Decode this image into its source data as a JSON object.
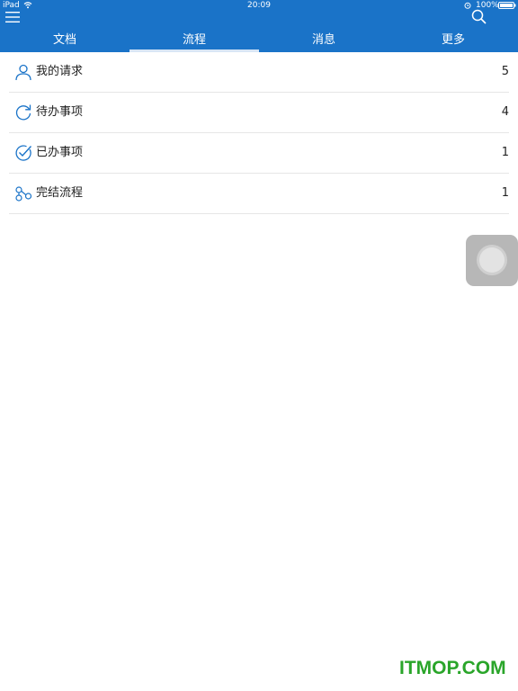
{
  "status_bar": {
    "carrier": "iPad",
    "time": "20:09",
    "battery": "100%",
    "icons": [
      "wifi-icon",
      "alarm-icon",
      "battery-icon"
    ]
  },
  "header": {
    "menu_icon": "menu-icon",
    "search_icon": "search-icon",
    "accent_color": "#1a73c8"
  },
  "tabs": [
    {
      "label": "文档",
      "active": false
    },
    {
      "label": "流程",
      "active": true
    },
    {
      "label": "消息",
      "active": false
    },
    {
      "label": "更多",
      "active": false
    }
  ],
  "list": {
    "items": [
      {
        "label": "我的请求",
        "count": "5",
        "icon": "user-icon"
      },
      {
        "label": "待办事项",
        "count": "4",
        "icon": "refresh-icon"
      },
      {
        "label": "已办事项",
        "count": "1",
        "icon": "check-circle-icon"
      },
      {
        "label": "完结流程",
        "count": "1",
        "icon": "share-nodes-icon"
      }
    ]
  },
  "watermark": "ITMOP.COM"
}
